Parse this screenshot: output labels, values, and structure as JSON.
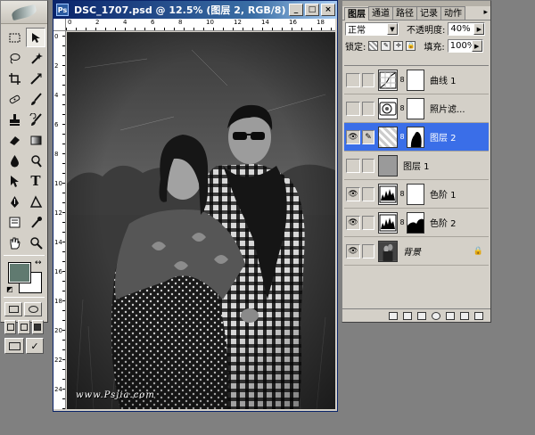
{
  "document": {
    "title": "DSC_1707.psd @ 12.5% (图层 2, RGB/8)",
    "window_buttons": {
      "minimize": "_",
      "maximize": "□",
      "close": "×"
    },
    "ruler_h": [
      "0",
      "2",
      "4",
      "6",
      "8",
      "10",
      "12",
      "14",
      "16",
      "18"
    ],
    "ruler_v": [
      "0",
      "2",
      "4",
      "6",
      "8",
      "10",
      "12",
      "14",
      "16",
      "18",
      "20",
      "22",
      "24"
    ],
    "watermark": "www.Psjia.com"
  },
  "tools": {
    "icons": [
      "marquee-icon",
      "move-icon",
      "lasso-icon",
      "magic-wand-icon",
      "crop-icon",
      "slice-icon",
      "healing-brush-icon",
      "brush-icon",
      "clone-stamp-icon",
      "history-brush-icon",
      "eraser-icon",
      "gradient-icon",
      "blur-icon",
      "dodge-icon",
      "path-selection-icon",
      "type-icon",
      "pen-icon",
      "shape-icon",
      "notes-icon",
      "eyedropper-icon",
      "hand-icon",
      "zoom-icon"
    ],
    "type_tool_glyph": "T",
    "foreground_color": "#607a70",
    "background_color": "#ffffff"
  },
  "layers_panel": {
    "tabs": [
      "图层",
      "通道",
      "路径",
      "记录",
      "动作"
    ],
    "active_tab": "图层",
    "menu_arrow": "▸",
    "blend_mode": "正常",
    "opacity_label": "不透明度:",
    "opacity_value": "40%",
    "lock_label": "锁定:",
    "fill_label": "填充:",
    "fill_value": "100%",
    "layers": [
      {
        "name": "曲线 1",
        "type": "curves",
        "visible": false,
        "selected": false
      },
      {
        "name": "照片滤...",
        "type": "photo-filter",
        "visible": false,
        "selected": false
      },
      {
        "name": "图层 2",
        "type": "texture",
        "visible": true,
        "selected": true
      },
      {
        "name": "图层 1",
        "type": "gray-fill",
        "visible": false,
        "selected": false
      },
      {
        "name": "色阶 1",
        "type": "levels",
        "visible": true,
        "selected": false
      },
      {
        "name": "色阶 2",
        "type": "levels-mask",
        "visible": true,
        "selected": false
      },
      {
        "name": "背景",
        "type": "background",
        "visible": true,
        "selected": false,
        "locked": true
      }
    ],
    "colors": {
      "selection": "#3a6ee8",
      "panel": "#d4d0c8"
    }
  }
}
